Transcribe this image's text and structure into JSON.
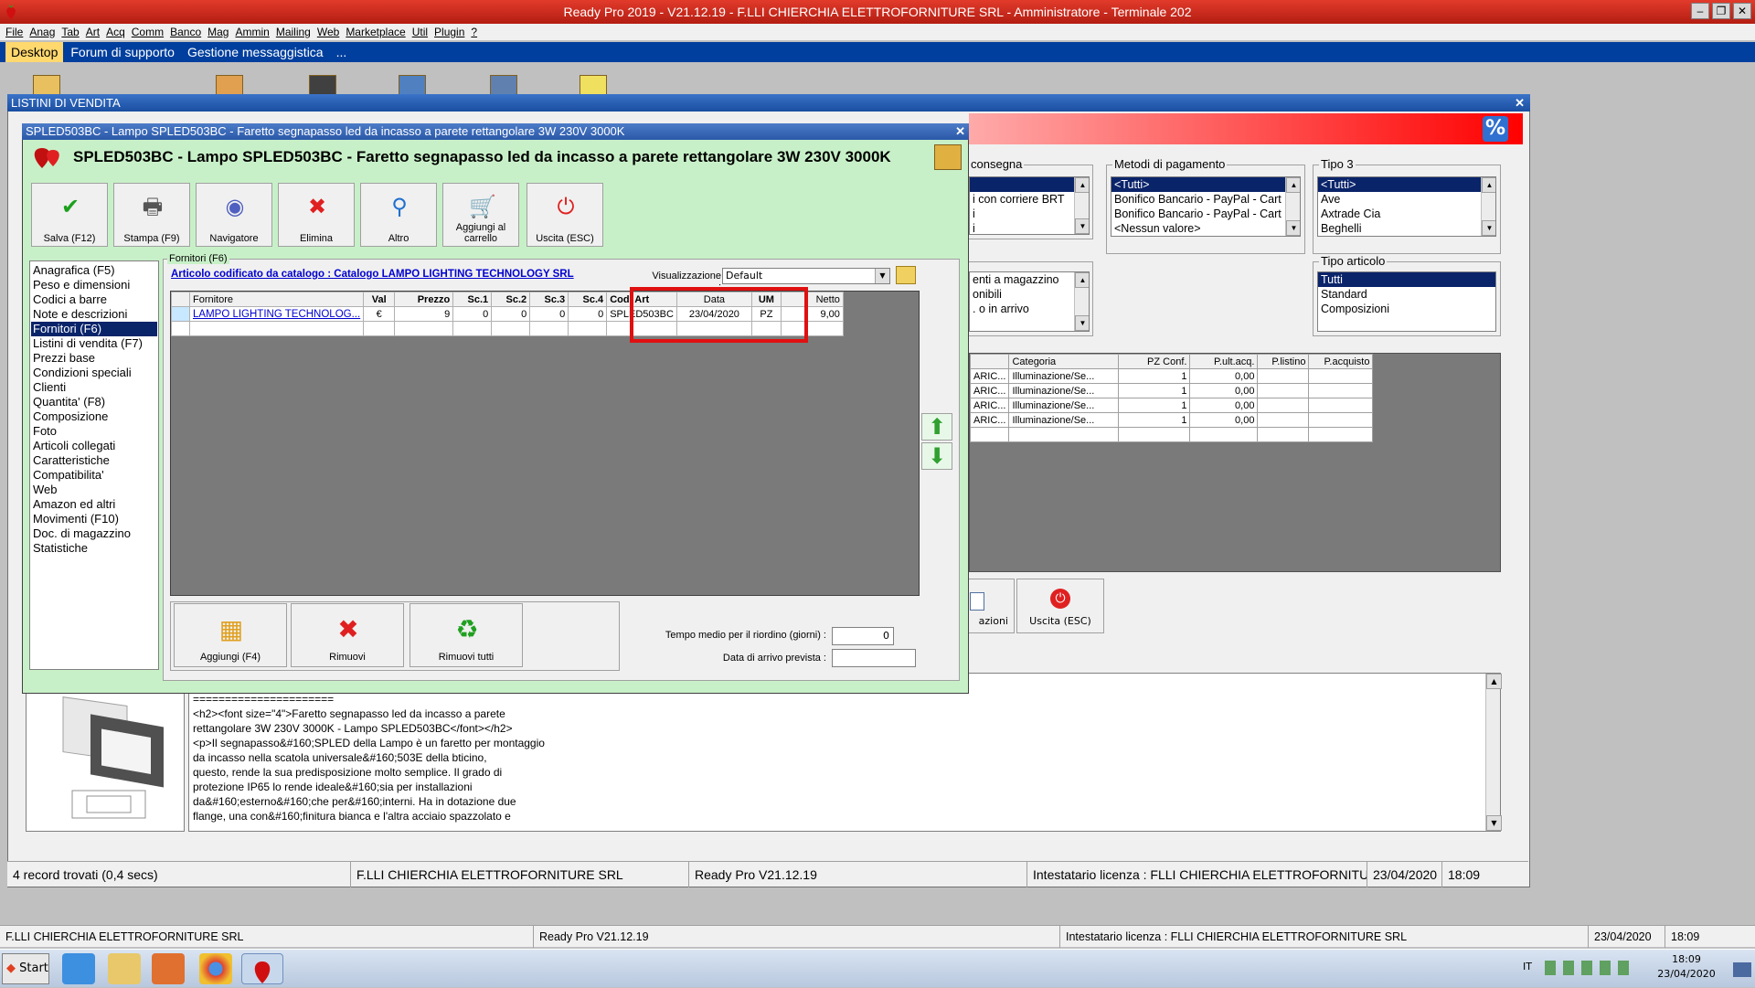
{
  "app": {
    "title": "Ready Pro 2019 - V21.12.19 - F.LLI CHIERCHIA ELETTROFORNITURE SRL - Amministratore - Terminale 202",
    "window_controls": [
      "–",
      "❐",
      "✕"
    ]
  },
  "menu": [
    "File",
    "Anag",
    "Tab",
    "Art",
    "Acq",
    "Comm",
    "Banco",
    "Mag",
    "Ammin",
    "Mailing",
    "Web",
    "Marketplace",
    "Util",
    "Plugin",
    "?"
  ],
  "tabs": [
    {
      "label": "Desktop",
      "active": true
    },
    {
      "label": "Forum di supporto",
      "active": false
    },
    {
      "label": "Gestione messaggistica",
      "active": false
    },
    {
      "label": "...",
      "active": false
    }
  ],
  "background_window": {
    "title": "LISTINI DI VENDITA",
    "close": "✕",
    "consegna": {
      "label": "consegna",
      "items": [
        "i con corriere BRT",
        "i",
        "i"
      ]
    },
    "metodi_pagamento": {
      "label": "Metodi di pagamento",
      "items": [
        "<Tutti>",
        "Bonifico Bancario - PayPal - Cart",
        "Bonifico Bancario - PayPal - Cart",
        "<Nessun valore>"
      ]
    },
    "tipo3": {
      "label": "Tipo 3",
      "items": [
        "<Tutti>",
        "Ave",
        "Axtrade Cia",
        "Beghelli"
      ]
    },
    "magazzino": {
      "items": [
        "",
        "enti a magazzino",
        "onibili",
        ". o in arrivo"
      ]
    },
    "tipo_articolo": {
      "label": "Tipo articolo",
      "items": [
        "Tutti",
        "Standard",
        "Composizioni"
      ]
    },
    "grid": {
      "headers": [
        "",
        "Categoria",
        "PZ Conf.",
        "P.ult.acq.",
        "P.listino",
        "P.acquisto"
      ],
      "rows": [
        [
          "ARIC...",
          "Illuminazione/Se...",
          "1",
          "0,00",
          "",
          ""
        ],
        [
          "ARIC...",
          "Illuminazione/Se...",
          "1",
          "0,00",
          "",
          ""
        ],
        [
          "ARIC...",
          "Illuminazione/Se...",
          "1",
          "0,00",
          "",
          ""
        ],
        [
          "ARIC...",
          "Illuminazione/Se...",
          "1",
          "0,00",
          "",
          ""
        ]
      ]
    },
    "btn_azioni": "azioni",
    "btn_uscita": "Uscita (ESC)",
    "description": "======================\n<h2><font size=\"4\">Faretto segnapasso led da incasso a parete\nrettangolare 3W 230V 3000K - Lampo SPLED503BC</font></h2>\n<p>Il segnapasso&#160;SPLED della Lampo è un faretto per montaggio\nda incasso nella scatola universale&#160;503E della bticino,\nquesto, rende la sua predisposizione molto semplice. Il grado di\nprotezione IP65 lo rende ideale&#160;sia per installazioni\nda&#160;esterno&#160;che per&#160;interni. Ha in dotazione due\nflange, una con&#160;finitura bianca e l'altra acciaio spazzolato e"
  },
  "dialog": {
    "title": "SPLED503BC - Lampo SPLED503BC - Faretto segnapasso led da incasso a parete rettangolare 3W 230V 3000K",
    "header": "SPLED503BC - Lampo SPLED503BC - Faretto segnapasso led da incasso a parete rettangolare 3W 230V 3000K",
    "close": "✕",
    "toolbar": [
      {
        "label": "Salva (F12)",
        "icon": "check-icon",
        "glyph": "✔",
        "color": "#1ca01c"
      },
      {
        "label": "Stampa (F9)",
        "icon": "printer-icon",
        "glyph": "🖶",
        "color": "#555555"
      },
      {
        "label": "Navigatore",
        "icon": "navigator-icon",
        "glyph": "◉",
        "color": "#5060c0"
      },
      {
        "label": "Elimina",
        "icon": "delete-icon",
        "glyph": "✖",
        "color": "#e02020"
      },
      {
        "label": "Altro",
        "icon": "search-icon",
        "glyph": "⚲",
        "color": "#2070d0"
      },
      {
        "label": "Aggiungi al carrello",
        "icon": "cart-icon",
        "glyph": "🛒",
        "color": "#606060"
      },
      {
        "label": "Uscita (ESC)",
        "icon": "power-icon",
        "glyph": "⏻",
        "color": "#e02020"
      }
    ],
    "nav": [
      "Anagrafica (F5)",
      "Peso e dimensioni",
      "Codici a barre",
      "Note e descrizioni",
      "Fornitori (F6)",
      "Listini di vendita (F7)",
      "Prezzi base",
      "Condizioni speciali",
      "Clienti",
      "Quantita' (F8)",
      "Composizione",
      "Foto",
      "Articoli collegati",
      "Caratteristiche",
      "Compatibilita'",
      "Web",
      "Amazon ed altri",
      "Movimenti (F10)",
      "Doc. di magazzino",
      "Statistiche"
    ],
    "nav_selected": 4,
    "fornitori": {
      "section_label": "Fornitori (F6)",
      "catalog_link": "Articolo codificato da catalogo : Catalogo LAMPO LIGHTING TECHNOLOGY SRL",
      "view_label": "Visualizzazione :",
      "view_value": "Default",
      "headers": [
        "",
        "Fornitore",
        "Val",
        "Prezzo",
        "Sc.1",
        "Sc.2",
        "Sc.3",
        "Sc.4",
        "Cod. Art",
        "Data",
        "UM",
        "Netto"
      ],
      "rows": [
        [
          "",
          "LAMPO LIGHTING TECHNOLOG...",
          "€",
          "9",
          "0",
          "0",
          "0",
          "0",
          "SPLED503BC",
          "23/04/2020",
          "PZ",
          "9,00"
        ]
      ],
      "buttons": [
        {
          "label": "Aggiungi (F4)",
          "icon": "add-icon",
          "glyph": "▦",
          "color": "#e0a020"
        },
        {
          "label": "Rimuovi",
          "icon": "remove-icon",
          "glyph": "✖",
          "color": "#e02020"
        },
        {
          "label": "Rimuovi tutti",
          "icon": "recycle-bin-icon",
          "glyph": "♻",
          "color": "#20a020"
        }
      ],
      "reorder_label": "Tempo medio per il riordino (giorni) :",
      "reorder_value": "0",
      "arrival_label": "Data di arrivo prevista :",
      "arrival_value": ""
    }
  },
  "status1": [
    "4 record trovati (0,4 secs)",
    "F.LLI CHIERCHIA ELETTROFORNITURE SRL",
    "Ready Pro V21.12.19",
    "Intestatario licenza : FLLI CHIERCHIA ELETTROFORNITURE",
    "23/04/2020",
    "18:09"
  ],
  "status2": [
    "F.LLI CHIERCHIA ELETTROFORNITURE SRL",
    "Ready Pro V21.12.19",
    "Intestatario licenza : FLLI CHIERCHIA ELETTROFORNITURE SRL",
    "23/04/2020",
    "18:09"
  ],
  "taskbar": {
    "start": "Start",
    "lang": "IT",
    "time": "18:09",
    "date": "23/04/2020"
  }
}
